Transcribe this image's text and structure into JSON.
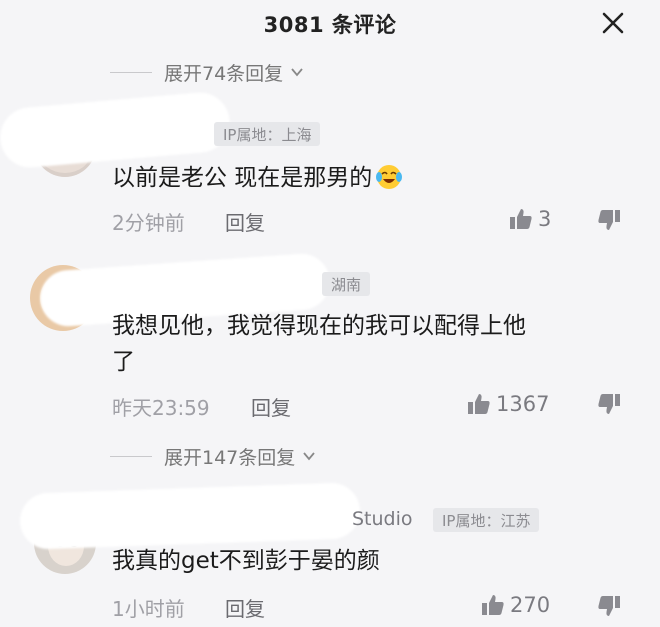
{
  "header": {
    "title": "3081 条评论"
  },
  "expand_top": {
    "label": "展开74条回复"
  },
  "comment1": {
    "ip_label": "IP属地：上海",
    "text": "以前是老公 现在是那男的",
    "emoji": "crying-laughing-emoji",
    "time": "2分钟前",
    "reply": "回复",
    "likes": "3"
  },
  "comment2": {
    "ip_fragment": "湖南",
    "text_line1": "我想见他，我觉得现在的我可以配得上他",
    "text_line2": "了",
    "time": "昨天23:59",
    "reply": "回复",
    "likes": "1367"
  },
  "expand_mid": {
    "label": "展开147条回复"
  },
  "comment3": {
    "username_fragment": "Studio",
    "ip_label": "IP属地：江苏",
    "text": "我真的get不到彭于晏的颜",
    "time": "1小时前",
    "reply": "回复",
    "likes": "270"
  },
  "colors": {
    "background": "#f5f5f7",
    "badge_bg": "#e6e7ea",
    "meta_gray": "#a0a0a6"
  }
}
